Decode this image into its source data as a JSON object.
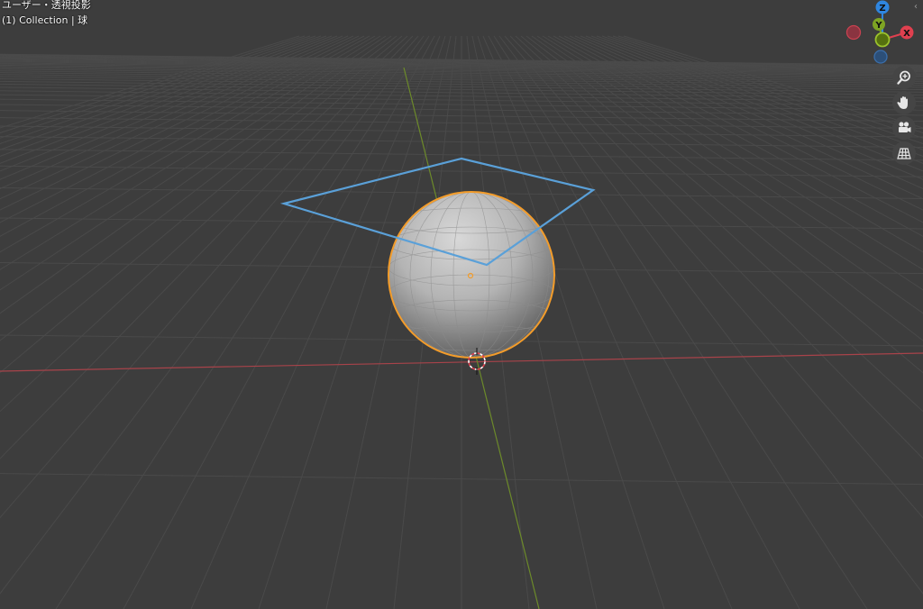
{
  "viewport": {
    "view_mode": "ユーザー・透視投影",
    "collection_info": "(1) Collection | 球"
  },
  "gizmo": {
    "axis_z": "Z",
    "axis_y": "Y",
    "axis_x": "X",
    "colors": {
      "x": "#e0404f",
      "y": "#7ea423",
      "z": "#2f86e0"
    }
  },
  "nav_buttons": [
    {
      "name": "zoom",
      "icon": "zoom-icon"
    },
    {
      "name": "pan",
      "icon": "hand-icon"
    },
    {
      "name": "camera",
      "icon": "camera-icon"
    },
    {
      "name": "perspective",
      "icon": "grid-icon"
    }
  ],
  "scene": {
    "selection_color": "#f39c2a",
    "camera_color": "#5aa0d8"
  }
}
